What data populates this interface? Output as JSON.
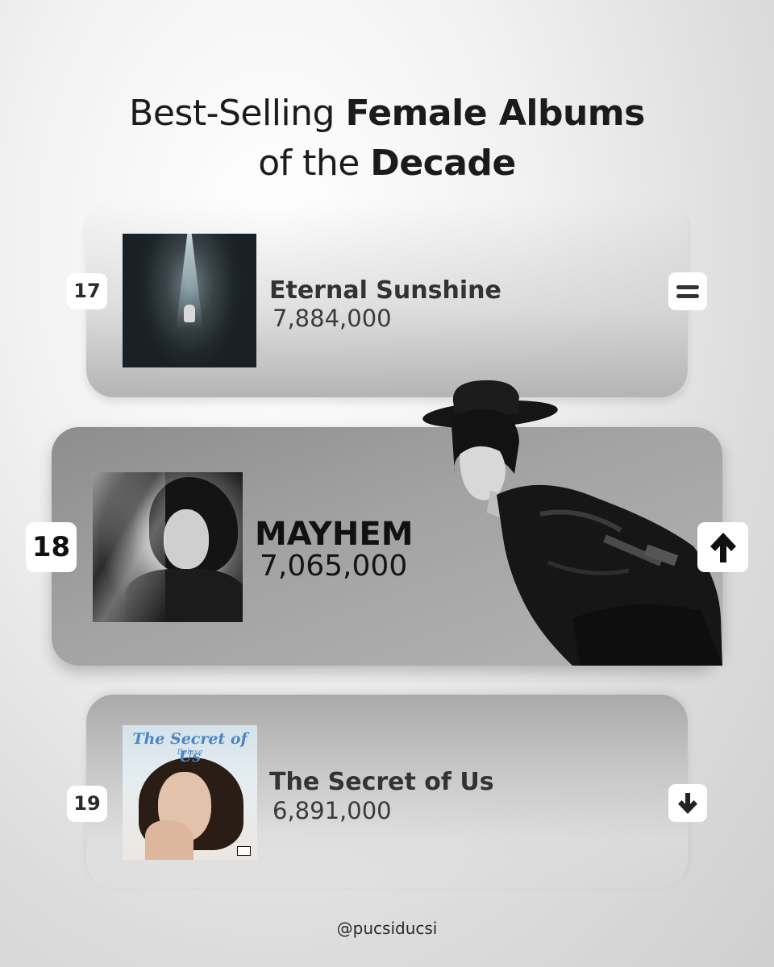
{
  "title": {
    "line1_light": "Best-Selling ",
    "line1_bold": "Female Albums",
    "line2_light": "of the ",
    "line2_bold": "Decade"
  },
  "entries": [
    {
      "rank": "17",
      "album": "Eternal Sunshine",
      "sales": "7,884,000",
      "trend_icon": "equals-icon"
    },
    {
      "rank": "18",
      "album": "MAYHEM",
      "sales": "7,065,000",
      "trend_icon": "arrow-up-icon"
    },
    {
      "rank": "19",
      "album": "The Secret of Us",
      "sales": "6,891,000",
      "trend_icon": "arrow-down-icon",
      "cover_title": "The Secret of Us",
      "cover_subtitle": "Deluxe"
    }
  ],
  "footer": {
    "handle": "@pucsiducsi"
  },
  "colors": {
    "badge_background": "#ffffff",
    "highlight_card": "#9e9e9e",
    "cover_title_blue": "#4a86c5"
  }
}
